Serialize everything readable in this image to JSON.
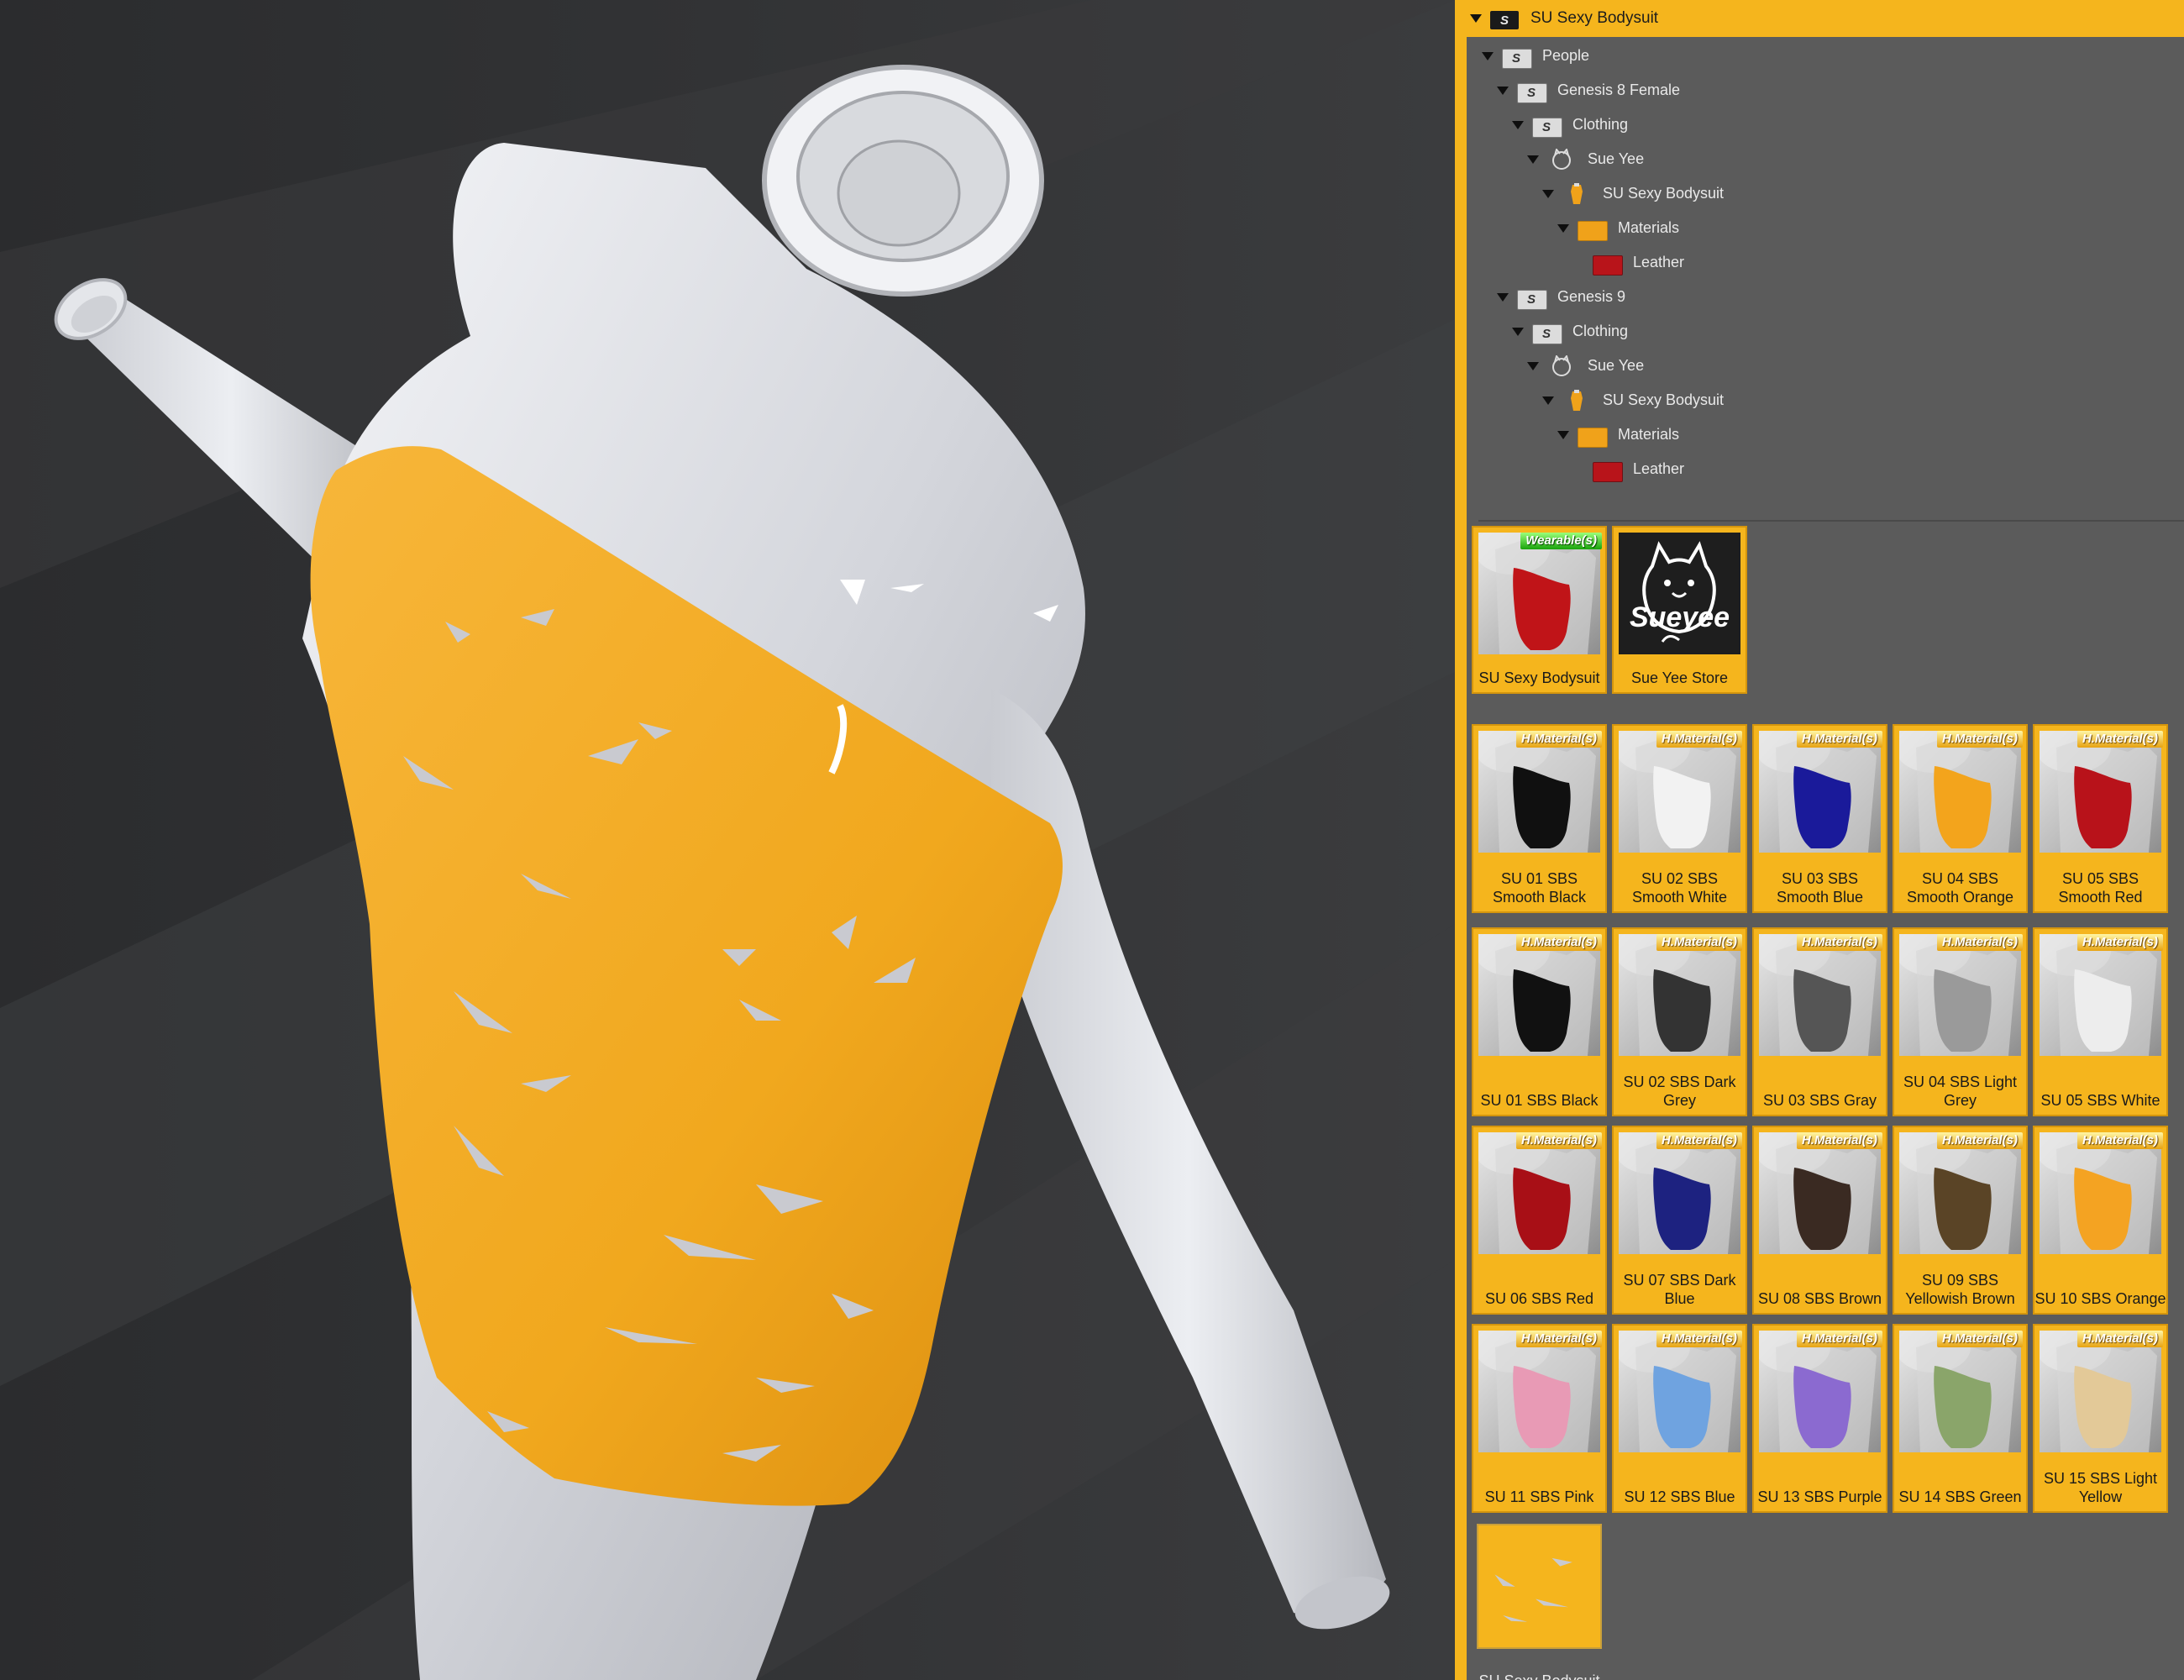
{
  "tree": {
    "root": "SU Sexy Bodysuit",
    "rows": [
      {
        "label": "People",
        "icon": "folder-icon"
      },
      {
        "label": "Genesis 8 Female",
        "icon": "folder-icon"
      },
      {
        "label": "Clothing",
        "icon": "folder-icon"
      },
      {
        "label": "Sue Yee",
        "icon": "vendor-icon"
      },
      {
        "label": "SU Sexy Bodysuit",
        "icon": "figure-icon"
      },
      {
        "label": "Materials",
        "icon": "materials-folder-icon"
      },
      {
        "label": "Leather",
        "icon": "leather-icon"
      },
      {
        "label": "Genesis 9",
        "icon": "folder-icon"
      },
      {
        "label": "Clothing",
        "icon": "folder-icon"
      },
      {
        "label": "Sue Yee",
        "icon": "vendor-icon"
      },
      {
        "label": "SU Sexy Bodysuit",
        "icon": "figure-icon"
      },
      {
        "label": "Materials",
        "icon": "materials-folder-icon"
      },
      {
        "label": "Leather",
        "icon": "leather-icon"
      }
    ]
  },
  "tiles": [
    {
      "label": "SU Sexy Bodysuit",
      "badge": "Wearable(s)",
      "color": "#c01418"
    },
    {
      "label": "Sue Yee Store",
      "badge": "",
      "logo": "Sueyee"
    },
    {
      "label": "SU 01 SBS Smooth Black",
      "badge": "H.Material(s)",
      "color": "#101010"
    },
    {
      "label": "SU 02 SBS Smooth White",
      "badge": "H.Material(s)",
      "color": "#f2f2f2"
    },
    {
      "label": "SU 03 SBS Smooth Blue",
      "badge": "H.Material(s)",
      "color": "#1a1a9a"
    },
    {
      "label": "SU 04 SBS Smooth Orange",
      "badge": "H.Material(s)",
      "color": "#f3a41c"
    },
    {
      "label": "SU 05 SBS Smooth Red",
      "badge": "H.Material(s)",
      "color": "#b8121a"
    },
    {
      "label": "SU 01 SBS Black",
      "badge": "H.Material(s)",
      "color": "#111111"
    },
    {
      "label": "SU 02 SBS Dark Grey",
      "badge": "H.Material(s)",
      "color": "#333333"
    },
    {
      "label": "SU 03 SBS Gray",
      "badge": "H.Material(s)",
      "color": "#555555"
    },
    {
      "label": "SU 04 SBS Light Grey",
      "badge": "H.Material(s)",
      "color": "#9a9a9a"
    },
    {
      "label": "SU 05 SBS White",
      "badge": "H.Material(s)",
      "color": "#ededed"
    },
    {
      "label": "SU 06 SBS Red",
      "badge": "H.Material(s)",
      "color": "#a80f16"
    },
    {
      "label": "SU 07 SBS Dark Blue",
      "badge": "H.Material(s)",
      "color": "#1d2280"
    },
    {
      "label": "SU 08 SBS Brown",
      "badge": "H.Material(s)",
      "color": "#3a2a22"
    },
    {
      "label": "SU 09 SBS Yellowish Brown",
      "badge": "H.Material(s)",
      "color": "#5a4426"
    },
    {
      "label": "SU 10 SBS Orange",
      "badge": "H.Material(s)",
      "color": "#f4a322"
    },
    {
      "label": "SU 11 SBS Pink",
      "badge": "H.Material(s)",
      "color": "#e89ab5"
    },
    {
      "label": "SU 12 SBS Blue",
      "badge": "H.Material(s)",
      "color": "#6fa3e0"
    },
    {
      "label": "SU 13 SBS Purple",
      "badge": "H.Material(s)",
      "color": "#8b6ad0"
    },
    {
      "label": "SU 14 SBS Green",
      "badge": "H.Material(s)",
      "color": "#8aa56a"
    },
    {
      "label": "SU 15 SBS Light Yellow",
      "badge": "H.Material(s)",
      "color": "#e3c998"
    },
    {
      "label": "SU Sexy Bodysuit Hole",
      "badge": "",
      "color": "#f5b51d"
    }
  ]
}
